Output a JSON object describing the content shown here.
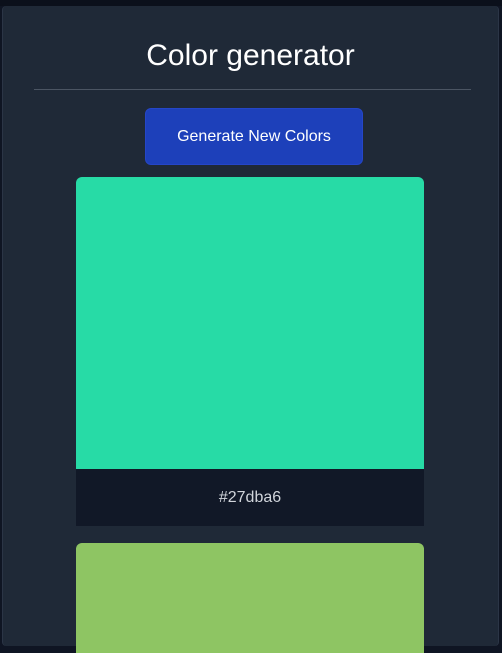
{
  "app": {
    "title": "Color generator",
    "generate_label": "Generate New Colors"
  },
  "colors": [
    {
      "hex": "#27dba6",
      "label": "#27dba6"
    },
    {
      "hex": "#8ec563"
    }
  ]
}
